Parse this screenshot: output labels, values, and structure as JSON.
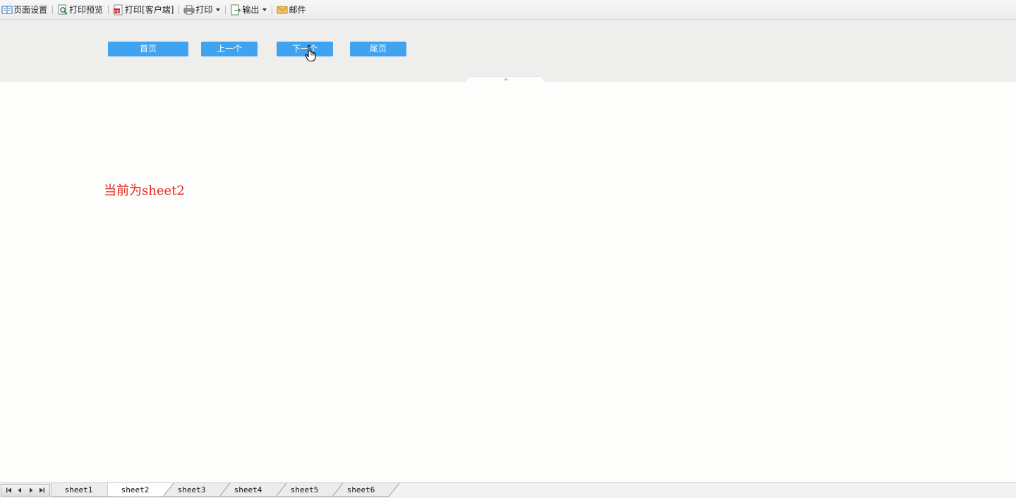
{
  "toolbar": {
    "page_setup": "页面设置",
    "print_preview": "打印预览",
    "print_client": "打印[客户端]",
    "print": "打印",
    "export": "输出",
    "mail": "邮件"
  },
  "nav_buttons": {
    "first": "首页",
    "prev": "上一个",
    "next": "下一个",
    "last": "尾页"
  },
  "content": {
    "message": "当前为sheet2"
  },
  "sheets": {
    "active_index": 1,
    "tabs": [
      "sheet1",
      "sheet2",
      "sheet3",
      "sheet4",
      "sheet5",
      "sheet6"
    ]
  },
  "colors": {
    "button_bg": "#3fa3f0",
    "message_text": "#e8261c",
    "panel_bg": "#eeeeed"
  }
}
